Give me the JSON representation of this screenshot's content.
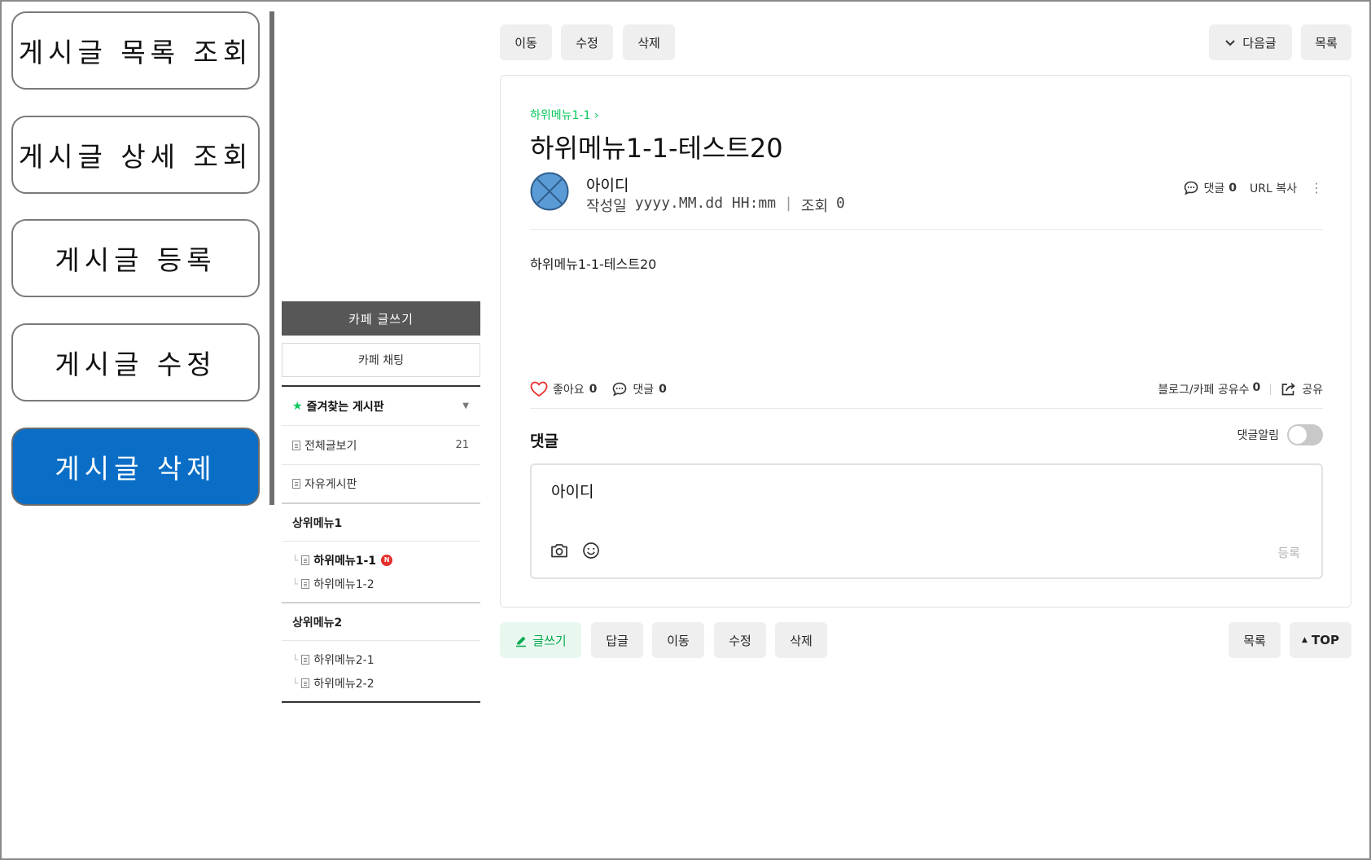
{
  "left_nav": {
    "items": [
      {
        "label": "게시글 목록 조회"
      },
      {
        "label": "게시글 상세 조회"
      },
      {
        "label": "게시글 등록"
      },
      {
        "label": "게시글 수정"
      },
      {
        "label": "게시글 삭제"
      }
    ],
    "active_index": 4,
    "active_color": "#0a6ec7"
  },
  "top_bar": {
    "move": "이동",
    "edit": "수정",
    "delete": "삭제",
    "next": "다음글",
    "list": "목록"
  },
  "cafe_sidebar": {
    "write": "카페 글쓰기",
    "chat": "카페 채팅",
    "favorites": "즐겨찾는 게시판",
    "all_posts": "전체글보기",
    "all_posts_count": "21",
    "free_board": "자유게시판",
    "groups": [
      {
        "name": "상위메뉴1",
        "children": [
          "하위메뉴1-1",
          "하위메뉴1-2"
        ]
      },
      {
        "name": "상위메뉴2",
        "children": [
          "하위메뉴2-1",
          "하위메뉴2-2"
        ]
      }
    ],
    "new_badge": "N"
  },
  "article": {
    "breadcrumb": "하위메뉴1-1",
    "title": "하위메뉴1-1-테스트20",
    "author": "아이디",
    "date_label": "작성일",
    "date_value": "yyyy.MM.dd HH:mm",
    "views_label": "조회",
    "views": "0",
    "comment_label": "댓글",
    "comment_count": "0",
    "url_copy": "URL 복사",
    "body": "하위메뉴1-1-테스트20",
    "like_label": "좋아요",
    "like_count": "0",
    "comment_label2": "댓글",
    "comment_count2": "0",
    "blog_share_label": "블로그/카페 공유수",
    "blog_share_count": "0",
    "share_label": "공유",
    "comments_heading": "댓글",
    "comment_alarm": "댓글알림",
    "comment_writer": "아이디",
    "comment_submit": "등록"
  },
  "bottom_bar": {
    "write": "글쓰기",
    "reply": "답글",
    "move": "이동",
    "edit": "수정",
    "delete": "삭제",
    "list": "목록",
    "top": "TOP"
  },
  "colors": {
    "naver_green": "#03c75a",
    "like_red": "#e5302c"
  }
}
